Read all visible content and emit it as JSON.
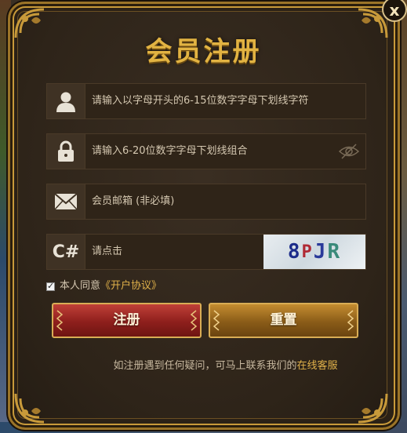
{
  "dialog": {
    "title": "会员注册",
    "close_label": "x"
  },
  "fields": {
    "username": {
      "placeholder": "请输入以字母开头的6-15位数字字母下划线字符",
      "icon": "user-icon"
    },
    "password": {
      "placeholder": "请输入6-20位数字字母下划线组合",
      "icon": "lock-icon",
      "toggle_icon": "eye-slash-icon"
    },
    "email": {
      "placeholder": "会员邮箱 (非必填)",
      "icon": "envelope-icon"
    },
    "captcha": {
      "placeholder": "请点击",
      "icon_text": "C#",
      "code_chars": [
        "8",
        "P",
        "J",
        "R"
      ]
    }
  },
  "agreement": {
    "checked": true,
    "label": "本人同意",
    "link": "《开户协议》"
  },
  "buttons": {
    "register": "注册",
    "reset": "重置"
  },
  "help": {
    "text": "如注册遇到任何疑问，可马上联系我们的",
    "link": "在线客服"
  },
  "colors": {
    "accent_gold": "#e2b342",
    "register_red": "#8e1f1c",
    "reset_brown": "#8a5c18",
    "link_gold": "#e0b14a"
  }
}
